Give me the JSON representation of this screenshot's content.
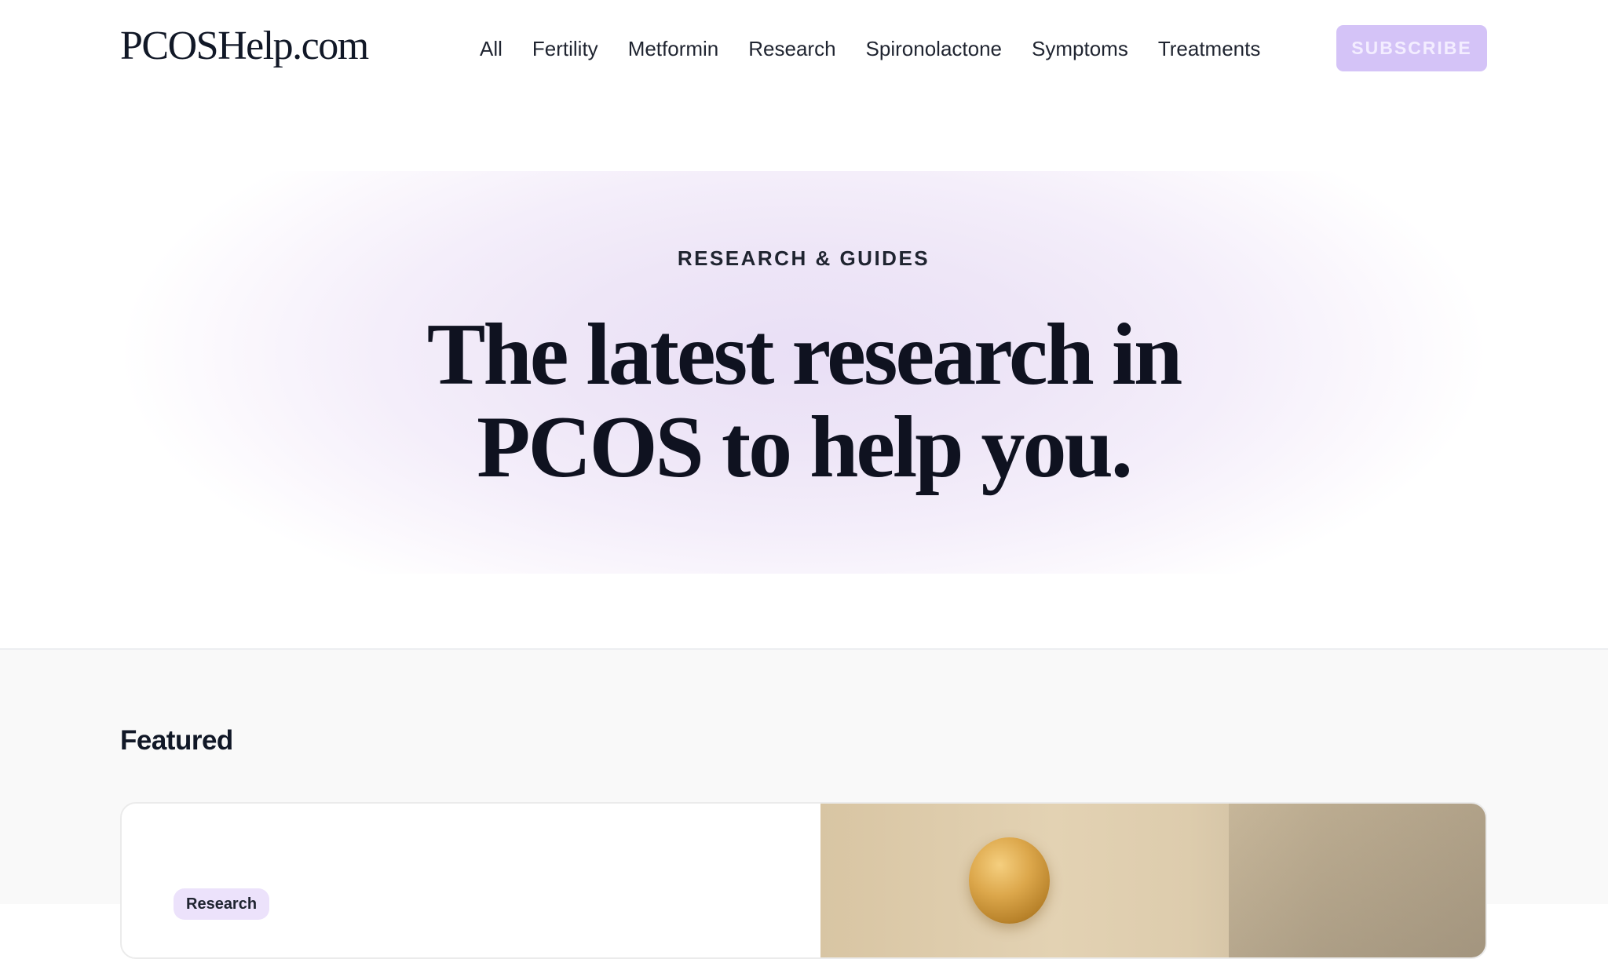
{
  "header": {
    "logo": "PCOSHelp.com",
    "nav": [
      {
        "label": "All"
      },
      {
        "label": "Fertility"
      },
      {
        "label": "Metformin"
      },
      {
        "label": "Research"
      },
      {
        "label": "Spironolactone"
      },
      {
        "label": "Symptoms"
      },
      {
        "label": "Treatments"
      }
    ],
    "subscribe_label": "SUBSCRIBE"
  },
  "hero": {
    "eyebrow": "RESEARCH & GUIDES",
    "title_line1": "The latest research in",
    "title_line2": "PCOS to help you."
  },
  "featured": {
    "heading": "Featured",
    "card": {
      "tag": "Research"
    }
  },
  "colors": {
    "accent": "#d4c3f7",
    "hero_tint": "#e9dff6",
    "tag_bg": "#ece2fb"
  }
}
